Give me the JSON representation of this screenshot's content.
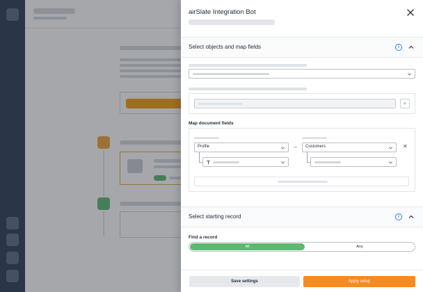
{
  "panel": {
    "title": "airSlate Integration Bot",
    "close_icon": "close-icon"
  },
  "section_map": {
    "label": "Select objects and map fields",
    "info_icon": "info-icon",
    "info_glyph": "i",
    "chevron_icon": "chevron-up-icon",
    "map_document_fields_label": "Map document fields",
    "left_select_value": "Profile",
    "right_select_value": "Customers",
    "arrow_glyph": "→",
    "remove_glyph": "✕",
    "plus_glyph": "+",
    "text_field_icon": "text-type-icon"
  },
  "section_start": {
    "label": "Select starting record",
    "info_icon": "info-icon",
    "info_glyph": "i",
    "chevron_icon": "chevron-up-icon",
    "find_record_label": "Find a record",
    "option_all": "All",
    "option_any": "Any",
    "selected": "All"
  },
  "footer": {
    "save_label": "Save settings",
    "apply_label": "Apply setup"
  },
  "colors": {
    "rail": "#2b3b55",
    "accent_orange": "#f68b1f",
    "toggle_green": "#5cb872",
    "info_blue": "#2f80ed"
  }
}
